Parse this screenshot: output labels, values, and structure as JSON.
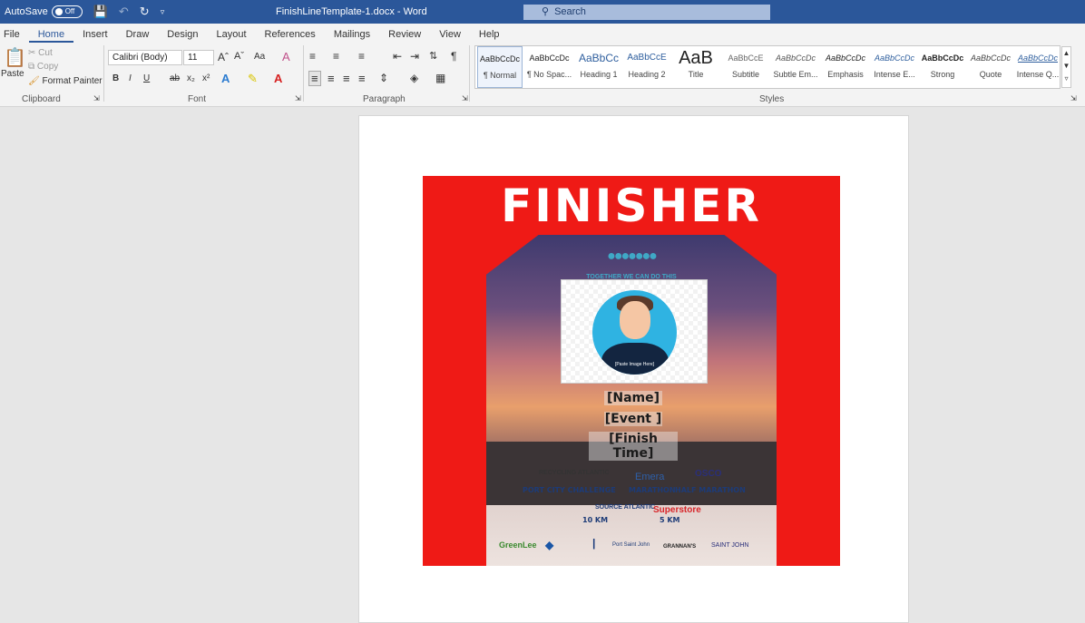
{
  "titlebar": {
    "autosave_label": "AutoSave",
    "autosave_state": "Off",
    "doc_title": "FinishLineTemplate-1.docx  -  Word",
    "search_placeholder": "Search"
  },
  "menu": [
    "File",
    "Home",
    "Insert",
    "Draw",
    "Design",
    "Layout",
    "References",
    "Mailings",
    "Review",
    "View",
    "Help"
  ],
  "clipboard": {
    "paste": "Paste",
    "cut": "Cut",
    "copy": "Copy",
    "format_painter": "Format Painter",
    "label": "Clipboard"
  },
  "font": {
    "family": "Calibri (Body)",
    "size": "11",
    "label": "Font",
    "bold": "B",
    "italic": "I",
    "underline": "U",
    "strike": "ab",
    "aa": "Aa"
  },
  "paragraph": {
    "label": "Paragraph"
  },
  "styles": {
    "label": "Styles",
    "items": [
      {
        "preview": "AaBbCcDc",
        "name": "¶ Normal"
      },
      {
        "preview": "AaBbCcDc",
        "name": "¶ No Spac..."
      },
      {
        "preview": "AaBbCc",
        "name": "Heading 1"
      },
      {
        "preview": "AaBbCcE",
        "name": "Heading 2"
      },
      {
        "preview": "AaB",
        "name": "Title"
      },
      {
        "preview": "AaBbCcE",
        "name": "Subtitle"
      },
      {
        "preview": "AaBbCcDc",
        "name": "Subtle Em..."
      },
      {
        "preview": "AaBbCcDc",
        "name": "Emphasis"
      },
      {
        "preview": "AaBbCcDc",
        "name": "Intense E..."
      },
      {
        "preview": "AaBbCcDc",
        "name": "Strong"
      },
      {
        "preview": "AaBbCcDc",
        "name": "Quote"
      },
      {
        "preview": "AaBbCcDc",
        "name": "Intense Q..."
      }
    ]
  },
  "certificate": {
    "title": "FINISHER",
    "crowd_caption": "TOGETHER WE CAN DO THIS",
    "photo_placeholder": "[Paste Image Here]",
    "name_field": "[Name]",
    "event_field": "[Event ]",
    "time_field": "[Finish Time]",
    "sponsor1": "RECYCLING ATLANTIC",
    "sponsor2": "Emera",
    "sponsor3": "OSCO",
    "event1": "PORT CITY CHALLENGE",
    "event2": "MARATHON",
    "event3": "HALF MARATHON",
    "sponsor4": "SOURCE ATLANTIC",
    "sponsor5": "Superstore",
    "event4": "10 KM",
    "event5": "5 KM",
    "footer_logos": [
      "GreenLee",
      "Domino's",
      "Port Saint John",
      "GRANNAN'S",
      "SAINT JOHN"
    ]
  },
  "colors": {
    "word_blue": "#2b579a",
    "cert_red": "#ef1a16"
  }
}
